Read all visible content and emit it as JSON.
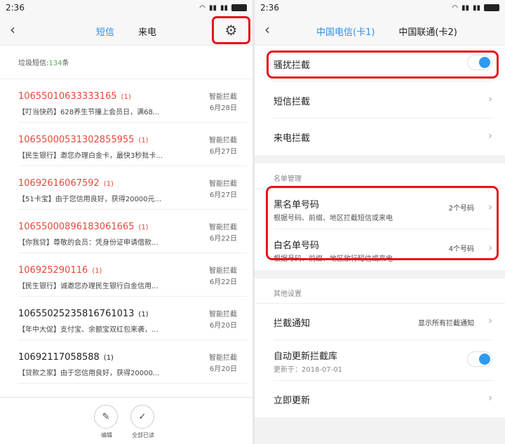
{
  "left": {
    "status": {
      "time": "2:36"
    },
    "tabs": [
      "短信",
      "来电"
    ],
    "spam_label": "垃圾短信:",
    "spam_count": "134",
    "spam_unit": "条",
    "messages": [
      {
        "number": "10655010633333165",
        "count": "(1)",
        "preview": "【叮当快药】628养生节撞上会员日，满68...",
        "tag": "智能拦截",
        "date": "6月28日",
        "red": true
      },
      {
        "number": "10655000531302855955",
        "count": "(1)",
        "preview": "【民生银行】邀您办理白金卡，最快3秒批卡...",
        "tag": "智能拦截",
        "date": "6月27日",
        "red": true
      },
      {
        "number": "10692616067592",
        "count": "(1)",
        "preview": "【51卡宝】由于您信用良好，获得20000元...",
        "tag": "智能拦截",
        "date": "6月27日",
        "red": true
      },
      {
        "number": "10655000896183061665",
        "count": "(1)",
        "preview": "【你我贷】尊敬的会员：凭身份证申请借款...",
        "tag": "智能拦截",
        "date": "6月22日",
        "red": true
      },
      {
        "number": "106925290116",
        "count": "(1)",
        "preview": "【民生银行】诚邀您办理民生银行白金信用...",
        "tag": "智能拦截",
        "date": "6月22日",
        "red": true
      },
      {
        "number": "10655025235816761013",
        "count": "(1)",
        "preview": "【年中大促】支付宝、余额宝双红包来袭，...",
        "tag": "智能拦截",
        "date": "6月20日",
        "red": false
      },
      {
        "number": "10692117058588",
        "count": "(1)",
        "preview": "【贷款之家】由于您信用良好，获得20000...",
        "tag": "智能拦截",
        "date": "6月20日",
        "red": false
      }
    ],
    "bottom": {
      "edit": "编辑",
      "read_all": "全部已读"
    }
  },
  "right": {
    "status": {
      "time": "2:36"
    },
    "tabs": [
      "中国电信(卡1)",
      "中国联通(卡2)"
    ],
    "harass": "骚扰拦截",
    "sms_block": "短信拦截",
    "call_block": "来电拦截",
    "list_section": "名单管理",
    "blacklist": {
      "title": "黑名单号码",
      "sub": "根据号码、前缀、地区拦截短信或来电",
      "value": "2个号码"
    },
    "whitelist": {
      "title": "白名单号码",
      "sub": "根据号码、前缀、地区放行短信或来电",
      "value": "4个号码"
    },
    "other_section": "其他设置",
    "notify": {
      "title": "拦截通知",
      "value": "显示所有拦截通知"
    },
    "auto_update": {
      "title": "自动更新拦截库",
      "sub": "更新于：2018-07-01"
    },
    "update_now": "立即更新"
  }
}
